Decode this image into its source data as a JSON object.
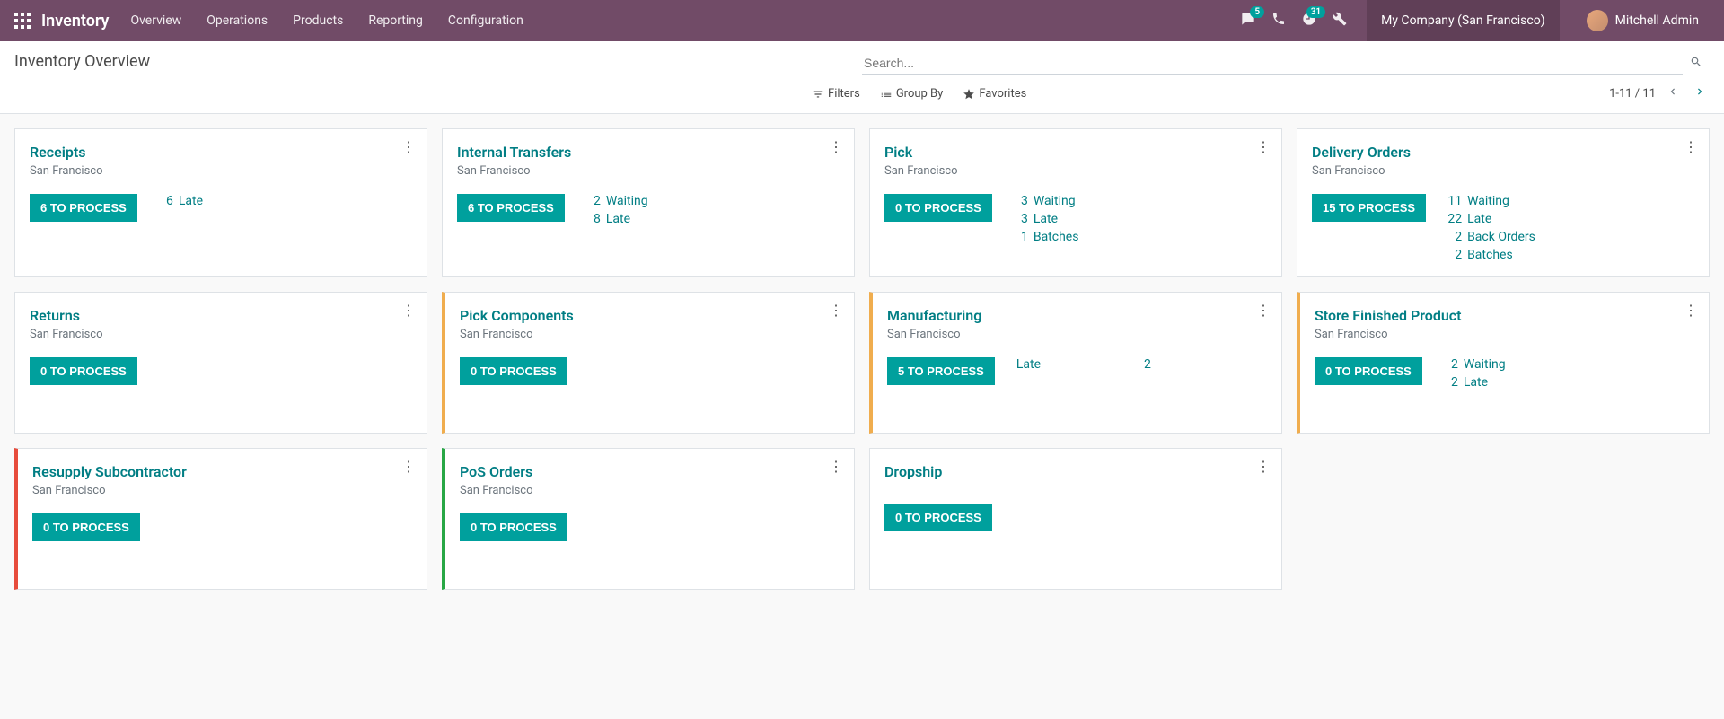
{
  "nav": {
    "brand": "Inventory",
    "items": [
      "Overview",
      "Operations",
      "Products",
      "Reporting",
      "Configuration"
    ],
    "messages_badge": "5",
    "activities_badge": "31",
    "company": "My Company (San Francisco)",
    "user": "Mitchell Admin"
  },
  "page": {
    "title": "Inventory Overview",
    "search_placeholder": "Search...",
    "filters_label": "Filters",
    "groupby_label": "Group By",
    "favorites_label": "Favorites",
    "pager": "1-11 / 11"
  },
  "cards": [
    {
      "title": "Receipts",
      "sub": "San Francisco",
      "button": "6 TO PROCESS",
      "bar": "",
      "stats": [
        {
          "count": "6",
          "label": "Late"
        }
      ]
    },
    {
      "title": "Internal Transfers",
      "sub": "San Francisco",
      "button": "6 TO PROCESS",
      "bar": "",
      "stats": [
        {
          "count": "2",
          "label": "Waiting"
        },
        {
          "count": "8",
          "label": "Late"
        }
      ]
    },
    {
      "title": "Pick",
      "sub": "San Francisco",
      "button": "0 TO PROCESS",
      "bar": "",
      "stats": [
        {
          "count": "3",
          "label": "Waiting"
        },
        {
          "count": "3",
          "label": "Late"
        },
        {
          "count": "1",
          "label": "Batches"
        }
      ]
    },
    {
      "title": "Delivery Orders",
      "sub": "San Francisco",
      "button": "15 TO PROCESS",
      "bar": "",
      "stats": [
        {
          "count": "11",
          "label": "Waiting"
        },
        {
          "count": "22",
          "label": "Late"
        },
        {
          "count": "2",
          "label": "Back Orders"
        },
        {
          "count": "2",
          "label": "Batches"
        }
      ]
    },
    {
      "title": "Returns",
      "sub": "San Francisco",
      "button": "0 TO PROCESS",
      "bar": "",
      "stats": []
    },
    {
      "title": "Pick Components",
      "sub": "San Francisco",
      "button": "0 TO PROCESS",
      "bar": "orange",
      "stats": []
    },
    {
      "title": "Manufacturing",
      "sub": "San Francisco",
      "button": "5 TO PROCESS",
      "bar": "orange",
      "stats_wide": [
        {
          "label": "Late",
          "count": "2"
        }
      ]
    },
    {
      "title": "Store Finished Product",
      "sub": "San Francisco",
      "button": "0 TO PROCESS",
      "bar": "orange",
      "stats": [
        {
          "count": "2",
          "label": "Waiting"
        },
        {
          "count": "2",
          "label": "Late"
        }
      ]
    },
    {
      "title": "Resupply Subcontractor",
      "sub": "San Francisco",
      "button": "0 TO PROCESS",
      "bar": "red",
      "stats": []
    },
    {
      "title": "PoS Orders",
      "sub": "San Francisco",
      "button": "0 TO PROCESS",
      "bar": "green",
      "stats": []
    },
    {
      "title": "Dropship",
      "sub": "",
      "button": "0 TO PROCESS",
      "bar": "",
      "stats": []
    }
  ]
}
